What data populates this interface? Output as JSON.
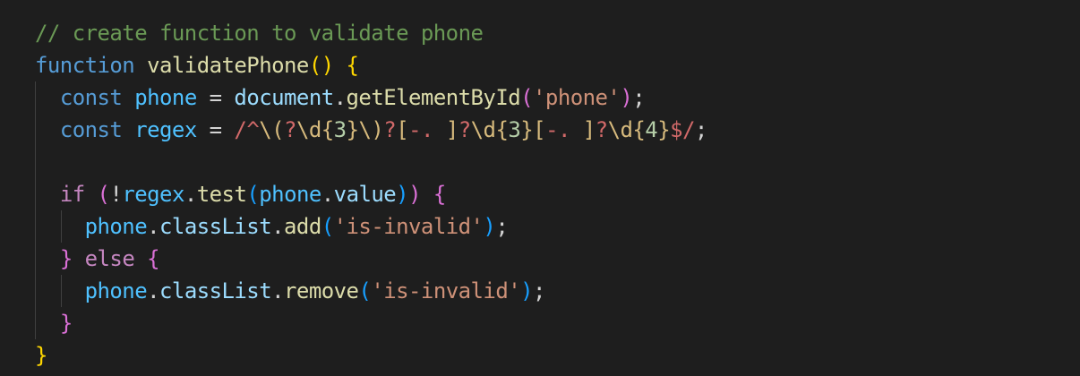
{
  "editor": {
    "lines": [
      {
        "indent": 0,
        "tokens": [
          {
            "t": "// create function to validate phone",
            "c": "comment"
          }
        ]
      },
      {
        "indent": 0,
        "tokens": [
          {
            "t": "function",
            "c": "keyword"
          },
          {
            "t": " ",
            "c": "punc"
          },
          {
            "t": "validatePhone",
            "c": "func"
          },
          {
            "t": "()",
            "c": "b1"
          },
          {
            "t": " ",
            "c": "punc"
          },
          {
            "t": "{",
            "c": "b1"
          }
        ]
      },
      {
        "indent": 1,
        "tokens": [
          {
            "t": "const",
            "c": "keyword"
          },
          {
            "t": " ",
            "c": "punc"
          },
          {
            "t": "phone",
            "c": "const"
          },
          {
            "t": " = ",
            "c": "op"
          },
          {
            "t": "document",
            "c": "var"
          },
          {
            "t": ".",
            "c": "punc"
          },
          {
            "t": "getElementById",
            "c": "func"
          },
          {
            "t": "(",
            "c": "b2"
          },
          {
            "t": "'phone'",
            "c": "string"
          },
          {
            "t": ")",
            "c": "b2"
          },
          {
            "t": ";",
            "c": "punc"
          }
        ]
      },
      {
        "indent": 1,
        "tokens": [
          {
            "t": "const",
            "c": "keyword"
          },
          {
            "t": " ",
            "c": "punc"
          },
          {
            "t": "regex",
            "c": "const"
          },
          {
            "t": " = ",
            "c": "op"
          },
          {
            "t": "/^",
            "c": "regex"
          },
          {
            "t": "\\(",
            "c": "escape"
          },
          {
            "t": "?",
            "c": "regex"
          },
          {
            "t": "\\d",
            "c": "escape"
          },
          {
            "t": "{",
            "c": "escape"
          },
          {
            "t": "3",
            "c": "num"
          },
          {
            "t": "}",
            "c": "escape"
          },
          {
            "t": "\\)",
            "c": "escape"
          },
          {
            "t": "?",
            "c": "regex"
          },
          {
            "t": "[",
            "c": "escape"
          },
          {
            "t": "-. ",
            "c": "regex"
          },
          {
            "t": "]",
            "c": "escape"
          },
          {
            "t": "?",
            "c": "regex"
          },
          {
            "t": "\\d",
            "c": "escape"
          },
          {
            "t": "{",
            "c": "escape"
          },
          {
            "t": "3",
            "c": "num"
          },
          {
            "t": "}",
            "c": "escape"
          },
          {
            "t": "[",
            "c": "escape"
          },
          {
            "t": "-. ",
            "c": "regex"
          },
          {
            "t": "]",
            "c": "escape"
          },
          {
            "t": "?",
            "c": "regex"
          },
          {
            "t": "\\d",
            "c": "escape"
          },
          {
            "t": "{",
            "c": "escape"
          },
          {
            "t": "4",
            "c": "num"
          },
          {
            "t": "}",
            "c": "escape"
          },
          {
            "t": "$/",
            "c": "regex"
          },
          {
            "t": ";",
            "c": "punc"
          }
        ]
      },
      {
        "indent": 1,
        "tokens": []
      },
      {
        "indent": 1,
        "tokens": [
          {
            "t": "if",
            "c": "control"
          },
          {
            "t": " ",
            "c": "punc"
          },
          {
            "t": "(",
            "c": "b2"
          },
          {
            "t": "!",
            "c": "op"
          },
          {
            "t": "regex",
            "c": "const"
          },
          {
            "t": ".",
            "c": "punc"
          },
          {
            "t": "test",
            "c": "func"
          },
          {
            "t": "(",
            "c": "b3"
          },
          {
            "t": "phone",
            "c": "const"
          },
          {
            "t": ".",
            "c": "punc"
          },
          {
            "t": "value",
            "c": "var"
          },
          {
            "t": ")",
            "c": "b3"
          },
          {
            "t": ")",
            "c": "b2"
          },
          {
            "t": " ",
            "c": "punc"
          },
          {
            "t": "{",
            "c": "b2"
          }
        ]
      },
      {
        "indent": 2,
        "tokens": [
          {
            "t": "phone",
            "c": "const"
          },
          {
            "t": ".",
            "c": "punc"
          },
          {
            "t": "classList",
            "c": "var"
          },
          {
            "t": ".",
            "c": "punc"
          },
          {
            "t": "add",
            "c": "func"
          },
          {
            "t": "(",
            "c": "b3"
          },
          {
            "t": "'is-invalid'",
            "c": "string"
          },
          {
            "t": ")",
            "c": "b3"
          },
          {
            "t": ";",
            "c": "punc"
          }
        ]
      },
      {
        "indent": 1,
        "tokens": [
          {
            "t": "}",
            "c": "b2"
          },
          {
            "t": " ",
            "c": "punc"
          },
          {
            "t": "else",
            "c": "control"
          },
          {
            "t": " ",
            "c": "punc"
          },
          {
            "t": "{",
            "c": "b2"
          }
        ]
      },
      {
        "indent": 2,
        "tokens": [
          {
            "t": "phone",
            "c": "const"
          },
          {
            "t": ".",
            "c": "punc"
          },
          {
            "t": "classList",
            "c": "var"
          },
          {
            "t": ".",
            "c": "punc"
          },
          {
            "t": "remove",
            "c": "func"
          },
          {
            "t": "(",
            "c": "b3"
          },
          {
            "t": "'is-invalid'",
            "c": "string"
          },
          {
            "t": ")",
            "c": "b3"
          },
          {
            "t": ";",
            "c": "punc"
          }
        ]
      },
      {
        "indent": 1,
        "tokens": [
          {
            "t": "}",
            "c": "b2"
          }
        ]
      },
      {
        "indent": 0,
        "tokens": [
          {
            "t": "}",
            "c": "b1"
          }
        ]
      }
    ]
  }
}
